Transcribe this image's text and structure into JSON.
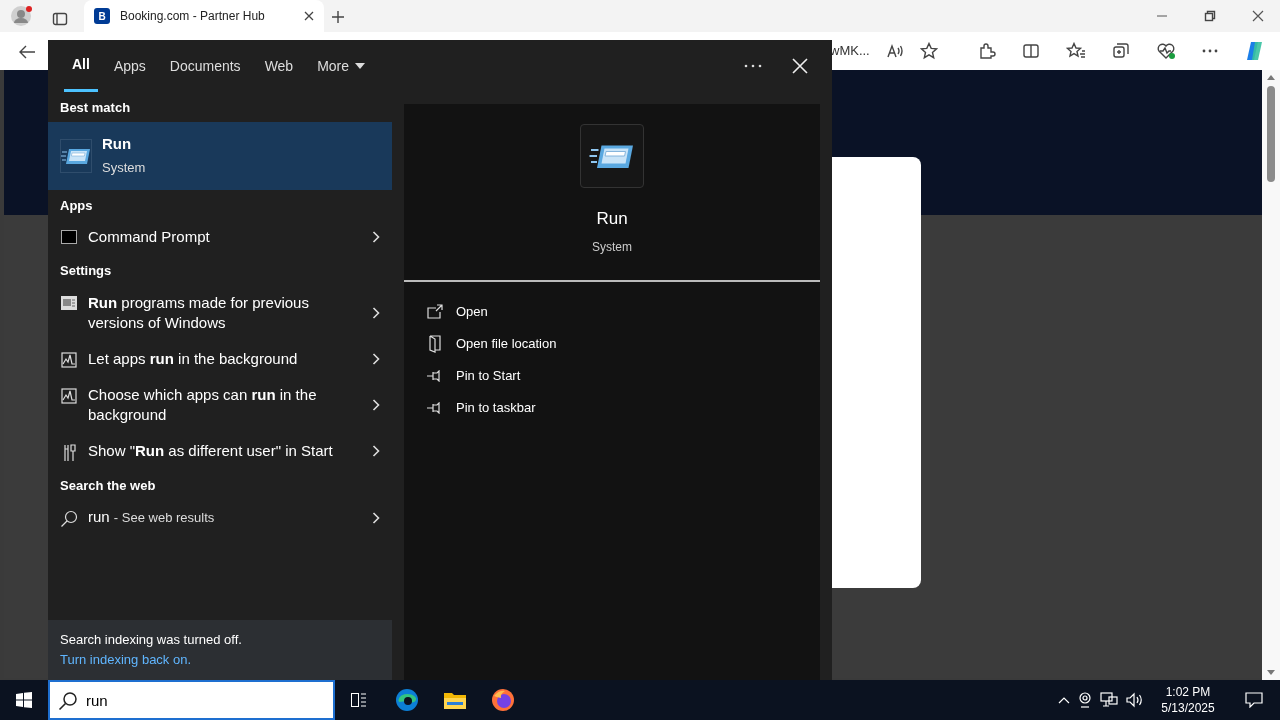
{
  "browser": {
    "tab_favicon": "B",
    "tab_title": "Booking.com - Partner Hub",
    "address_fragment": "wMK..."
  },
  "search": {
    "tabs": [
      {
        "label": "All",
        "selected": true,
        "kind": "tab"
      },
      {
        "label": "Apps",
        "selected": false,
        "kind": "tab"
      },
      {
        "label": "Documents",
        "selected": false,
        "kind": "tab"
      },
      {
        "label": "Web",
        "selected": false,
        "kind": "tab"
      },
      {
        "label": "More",
        "selected": false,
        "kind": "dropdown"
      }
    ],
    "sections": [
      {
        "heading": "Best match",
        "results": [
          {
            "kind": "best",
            "title": "Run",
            "subtitle": "System",
            "selected": true
          }
        ]
      },
      {
        "heading": "Apps",
        "results": [
          {
            "kind": "item",
            "title": "Command Prompt",
            "selected": false
          }
        ]
      },
      {
        "heading": "Settings",
        "results": [
          {
            "kind": "item",
            "title": "**Run** programs made for previous versions of Windows",
            "selected": false
          },
          {
            "kind": "item",
            "title": "Let apps **run** in the background",
            "selected": false
          },
          {
            "kind": "item",
            "title": "Choose which apps can **run** in the background",
            "selected": false
          },
          {
            "kind": "item",
            "title": "Show \"**Run** as different user\" in Start",
            "selected": false
          }
        ]
      },
      {
        "heading": "Search the web",
        "results": [
          {
            "kind": "web",
            "title": "run",
            "subtitle": "- See web results",
            "selected": false
          }
        ]
      }
    ],
    "preview": {
      "title": "Run",
      "subtitle": "System",
      "actions": [
        {
          "label": "Open"
        },
        {
          "label": "Open file location"
        },
        {
          "label": "Pin to Start"
        },
        {
          "label": "Pin to taskbar"
        }
      ]
    },
    "footer": {
      "notice": "Search indexing was turned off.",
      "link": "Turn indexing back on."
    }
  },
  "taskbar": {
    "search_value": "run",
    "time": "1:02 PM",
    "date": "5/13/2025"
  }
}
